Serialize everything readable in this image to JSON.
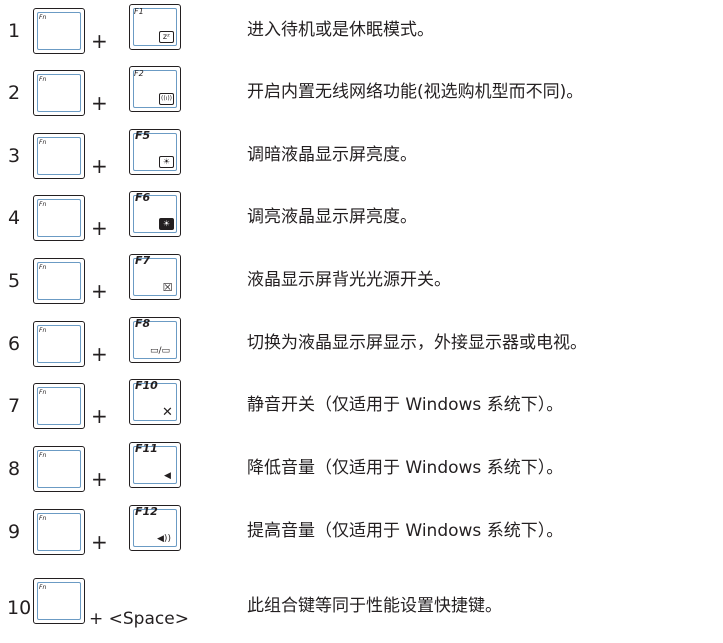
{
  "keys": {
    "fn_label": "Fn",
    "plus": "+",
    "space": "+ <Space>"
  },
  "rows": [
    {
      "num": "1",
      "fkey": "F1",
      "icon": "zᶻ",
      "desc": "进入待机或是休眠模式。"
    },
    {
      "num": "2",
      "fkey": "F2",
      "icon": "((ı))",
      "desc": "开启内置无线网络功能(视选购机型而不同)。"
    },
    {
      "num": "3",
      "fkey": "F5",
      "icon": "☀",
      "desc": "调暗液晶显示屏亮度。"
    },
    {
      "num": "4",
      "fkey": "F6",
      "icon": "☀",
      "desc": "调亮液晶显示屏亮度。"
    },
    {
      "num": "5",
      "fkey": "F7",
      "icon": "☒",
      "desc": "液晶显示屏背光光源开关。"
    },
    {
      "num": "6",
      "fkey": "F8",
      "icon": "▭/▭",
      "desc": "切换为液晶显示屏显示，外接显示器或电视。"
    },
    {
      "num": "7",
      "fkey": "F10",
      "icon": "✕",
      "desc": "静音开关（仅适用于 Windows 系统下）。"
    },
    {
      "num": "8",
      "fkey": "F11",
      "icon": "◀",
      "desc": "降低音量（仅适用于 Windows 系统下）。"
    },
    {
      "num": "9",
      "fkey": "F12",
      "icon": "◀))",
      "desc": "提高音量（仅适用于 Windows 系统下）。"
    },
    {
      "num": "10",
      "desc": "此组合键等同于性能设置快捷键。"
    }
  ]
}
